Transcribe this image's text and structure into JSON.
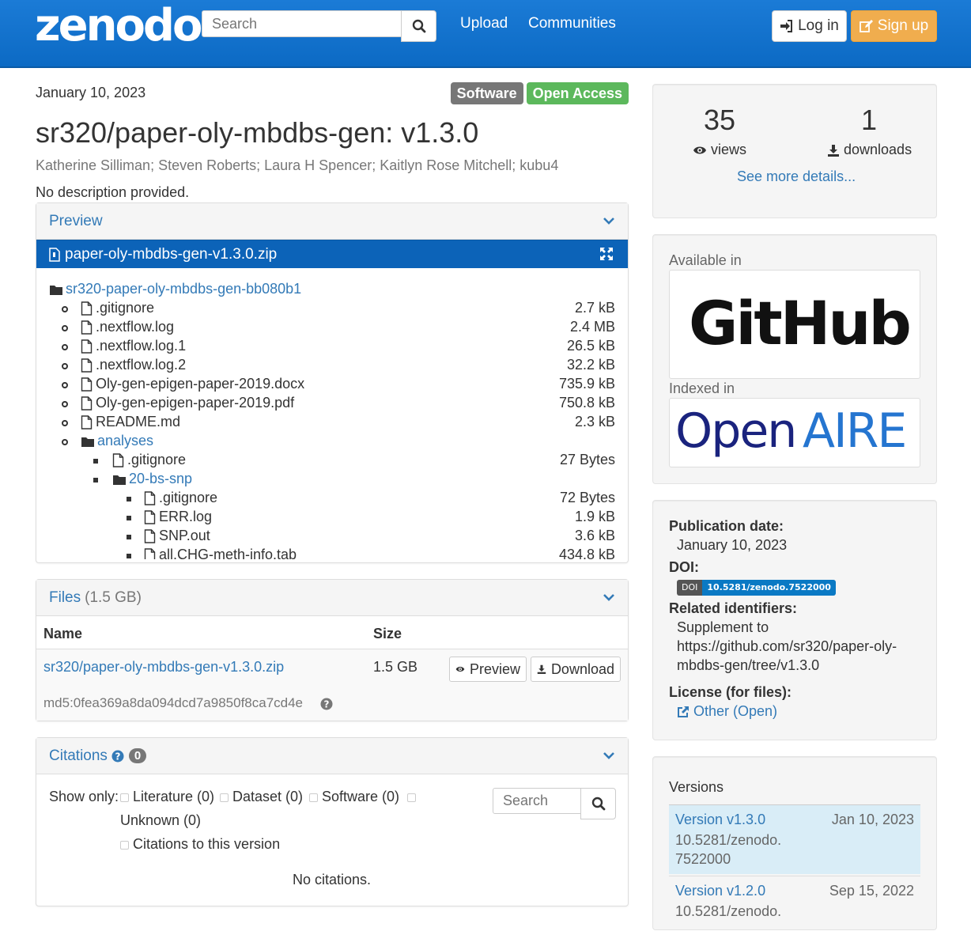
{
  "navbar": {
    "logo": "zenodo",
    "search_placeholder": "Search",
    "links": [
      "Upload",
      "Communities"
    ],
    "login_label": "Log in",
    "signup_label": "Sign up"
  },
  "record": {
    "date": "January 10, 2023",
    "labels": [
      "Software",
      "Open Access"
    ],
    "title": "sr320/paper-oly-mbdbs-gen: v1.3.0",
    "authors": "Katherine Silliman; Steven Roberts; Laura H Spencer; Kaitlyn Rose Mitchell; kubu4",
    "description": "No description provided."
  },
  "preview": {
    "heading": "Preview",
    "file": "paper-oly-mbdbs-gen-v1.3.0.zip",
    "tree": [
      {
        "name": "sr320-paper-oly-mbdbs-gen-bb080b1",
        "type": "folder",
        "level": 0,
        "size": ""
      },
      {
        "name": ".gitignore",
        "type": "file",
        "level": 1,
        "size": "2.7 kB"
      },
      {
        "name": ".nextflow.log",
        "type": "file",
        "level": 1,
        "size": "2.4 MB"
      },
      {
        "name": ".nextflow.log.1",
        "type": "file",
        "level": 1,
        "size": "26.5 kB"
      },
      {
        "name": ".nextflow.log.2",
        "type": "file",
        "level": 1,
        "size": "32.2 kB"
      },
      {
        "name": "Oly-gen-epigen-paper-2019.docx",
        "type": "file",
        "level": 1,
        "size": "735.9 kB"
      },
      {
        "name": "Oly-gen-epigen-paper-2019.pdf",
        "type": "file",
        "level": 1,
        "size": "750.8 kB"
      },
      {
        "name": "README.md",
        "type": "file",
        "level": 1,
        "size": "2.3 kB"
      },
      {
        "name": "analyses",
        "type": "folder",
        "level": 1,
        "size": ""
      },
      {
        "name": ".gitignore",
        "type": "file",
        "level": 2,
        "size": "27 Bytes"
      },
      {
        "name": "20-bs-snp",
        "type": "folder",
        "level": 2,
        "size": ""
      },
      {
        "name": ".gitignore",
        "type": "file",
        "level": 3,
        "size": "72 Bytes"
      },
      {
        "name": "ERR.log",
        "type": "file",
        "level": 3,
        "size": "1.9 kB"
      },
      {
        "name": "SNP.out",
        "type": "file",
        "level": 3,
        "size": "3.6 kB"
      },
      {
        "name": "all.CHG-meth-info.tab",
        "type": "file",
        "level": 3,
        "size": "434.8 kB"
      }
    ]
  },
  "files": {
    "heading": "Files",
    "total": "(1.5 GB)",
    "col_name": "Name",
    "col_size": "Size",
    "row": {
      "name": "sr320/paper-oly-mbdbs-gen-v1.3.0.zip",
      "size": "1.5 GB",
      "md5": "md5:0fea369a8da094dcd7a9850f8ca7cd4e",
      "preview_label": "Preview",
      "download_label": "Download"
    }
  },
  "citations": {
    "heading": "Citations",
    "count": "0",
    "show_only": "Show only:",
    "filters": [
      "Literature (0)",
      "Dataset (0)",
      "Software (0)",
      "Unknown (0)",
      "Citations to this version"
    ],
    "search_placeholder": "Search",
    "empty": "No citations."
  },
  "stats": {
    "views": "35",
    "views_label": "views",
    "downloads": "1",
    "downloads_label": "downloads",
    "more": "See more details..."
  },
  "availability": {
    "available_in": "Available in",
    "github": "GitHub",
    "indexed_in": "Indexed in",
    "openaire_1": "Open",
    "openaire_2": "AIRE"
  },
  "metadata": {
    "pub_date_label": "Publication date:",
    "pub_date": "January 10, 2023",
    "doi_label": "DOI:",
    "doi_badge_a": "DOI",
    "doi_badge_b": "10.5281/zenodo.7522000",
    "related_label": "Related identifiers:",
    "related_type": "Supplement to",
    "related_url_1": "https://github.com/sr320/paper-oly-",
    "related_url_2": "mbdbs-gen/tree/v1.3.0",
    "license_label": "License (for files):",
    "license": "Other (Open)"
  },
  "versions": {
    "heading": "Versions",
    "items": [
      {
        "version": "Version v1.3.0",
        "date": "Jan 10, 2023",
        "id1": "10.5281/zenodo.",
        "id2": "7522000"
      },
      {
        "version": "Version v1.2.0",
        "date": "Sep 15, 2022",
        "id1": "10.5281/zenodo.",
        "id2": ""
      }
    ]
  },
  "colors": {
    "navbar": "#0c6ac4",
    "link": "#337ab7",
    "open_access": "#5cb85c",
    "software": "#777777",
    "signup": "#f0ad4e"
  }
}
